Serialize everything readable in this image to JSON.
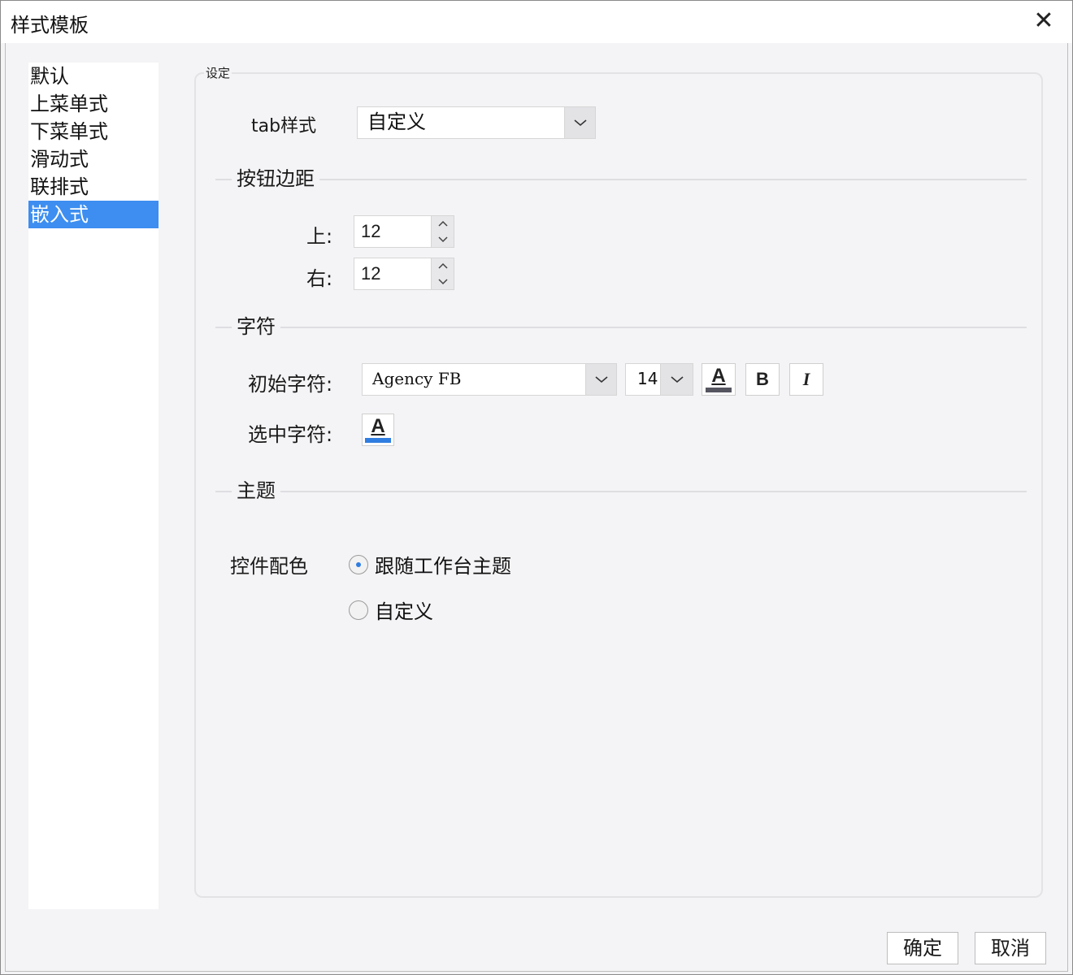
{
  "window": {
    "title": "样式模板",
    "close_glyph": "✕"
  },
  "sidebar": {
    "items": [
      {
        "label": "默认"
      },
      {
        "label": "上菜单式"
      },
      {
        "label": "下菜单式"
      },
      {
        "label": "滑动式"
      },
      {
        "label": "联排式"
      },
      {
        "label": "嵌入式",
        "selected": true
      }
    ]
  },
  "settings": {
    "legend": "设定",
    "tab_style": {
      "label": "tab样式",
      "value": "自定义"
    },
    "button_margin": {
      "section": "按钮边距",
      "top_label": "上:",
      "top_value": "12",
      "right_label": "右:",
      "right_value": "12"
    },
    "chars": {
      "section": "字符",
      "initial_label": "初始字符:",
      "font_value": "Agency FB",
      "size_value": "14",
      "font_color_glyph": "A",
      "font_color": "#555560",
      "bold_glyph": "B",
      "italic_glyph": "I",
      "selected_label": "选中字符:",
      "selected_color_glyph": "A",
      "selected_color": "#2f7de1"
    },
    "theme": {
      "section": "主题",
      "control_color_label": "控件配色",
      "options": [
        {
          "label": "跟随工作台主题",
          "checked": true
        },
        {
          "label": "自定义",
          "checked": false
        }
      ]
    }
  },
  "footer": {
    "ok_label": "确定",
    "cancel_label": "取消"
  },
  "colors": {
    "accent": "#3d8ef0",
    "panel_bg": "#f4f4f6"
  }
}
